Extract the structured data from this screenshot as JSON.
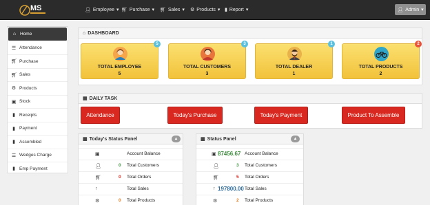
{
  "nav": {
    "logo_text": "MS",
    "items": [
      {
        "icon": "user-icon",
        "label": "Employee"
      },
      {
        "icon": "cart-icon",
        "label": "Purchase"
      },
      {
        "icon": "cart-icon",
        "label": "Sales"
      },
      {
        "icon": "cog-icon",
        "label": "Products"
      },
      {
        "icon": "file-icon",
        "label": "Report"
      }
    ],
    "admin_label": "Admin"
  },
  "sidebar": {
    "items": [
      {
        "icon": "home-icon",
        "label": "Home"
      },
      {
        "icon": "list-icon",
        "label": "Attendance"
      },
      {
        "icon": "cart-icon",
        "label": "Purchase"
      },
      {
        "icon": "cart-icon",
        "label": "Sales"
      },
      {
        "icon": "cog-icon",
        "label": "Products"
      },
      {
        "icon": "stack-icon",
        "label": "Stock"
      },
      {
        "icon": "file-icon",
        "label": "Receipts"
      },
      {
        "icon": "file-icon",
        "label": "Payment"
      },
      {
        "icon": "file-icon",
        "label": "Assembled"
      },
      {
        "icon": "list-icon",
        "label": "Wedges Charge"
      },
      {
        "icon": "file-icon",
        "label": "Emp Payment"
      }
    ]
  },
  "dashboard": {
    "title": "DASHBOARD",
    "cards": [
      {
        "title": "TOTAL EMPLOYEE",
        "value": "5",
        "badge": "5",
        "badge_color": "#5bc0de",
        "icon": "employee-avatar-icon"
      },
      {
        "title": "TOTAL CUSTOMERS",
        "value": "3",
        "badge": "3",
        "badge_color": "#5bc0de",
        "icon": "customer-avatar-icon"
      },
      {
        "title": "TOTAL DEALER",
        "value": "1",
        "badge": "1",
        "badge_color": "#5bc0de",
        "icon": "dealer-avatar-icon"
      },
      {
        "title": "TOTAL PRODUCTS",
        "value": "2",
        "badge": "2",
        "badge_color": "#e8543b",
        "icon": "bicycle-icon"
      }
    ]
  },
  "daily_task": {
    "title": "DAILY TASK",
    "buttons": [
      "Attendance",
      "Today's Purchase",
      "Today's Payment",
      "Product To Assemble"
    ]
  },
  "today_status": {
    "title": "Today's Status Panel",
    "rows": [
      {
        "icon": "briefcase-icon",
        "value": "",
        "label": "Account Balance"
      },
      {
        "icon": "user-icon",
        "value": "0",
        "label": "Total Customers"
      },
      {
        "icon": "cart-icon",
        "value": "0",
        "label": "Total Orders"
      },
      {
        "icon": "arrow-up-icon",
        "value": "",
        "label": "Total Sales"
      },
      {
        "icon": "cog-icon",
        "value": "0",
        "label": "Total Products"
      }
    ]
  },
  "status": {
    "title": "Status Panel",
    "rows": [
      {
        "icon": "briefcase-icon",
        "value": "87456.67",
        "label": "Account Balance"
      },
      {
        "icon": "user-icon",
        "value": "3",
        "label": "Total Customers"
      },
      {
        "icon": "cart-icon",
        "value": "5",
        "label": "Total Orders"
      },
      {
        "icon": "arrow-up-icon",
        "value": "197800.00",
        "label": "Total Sales"
      },
      {
        "icon": "cog-icon",
        "value": "2",
        "label": "Total Products"
      }
    ]
  },
  "colors": {
    "green": "#3c8c3c",
    "red": "#d9281f",
    "blue": "#2d6b9c",
    "orange": "#e07a1f"
  }
}
